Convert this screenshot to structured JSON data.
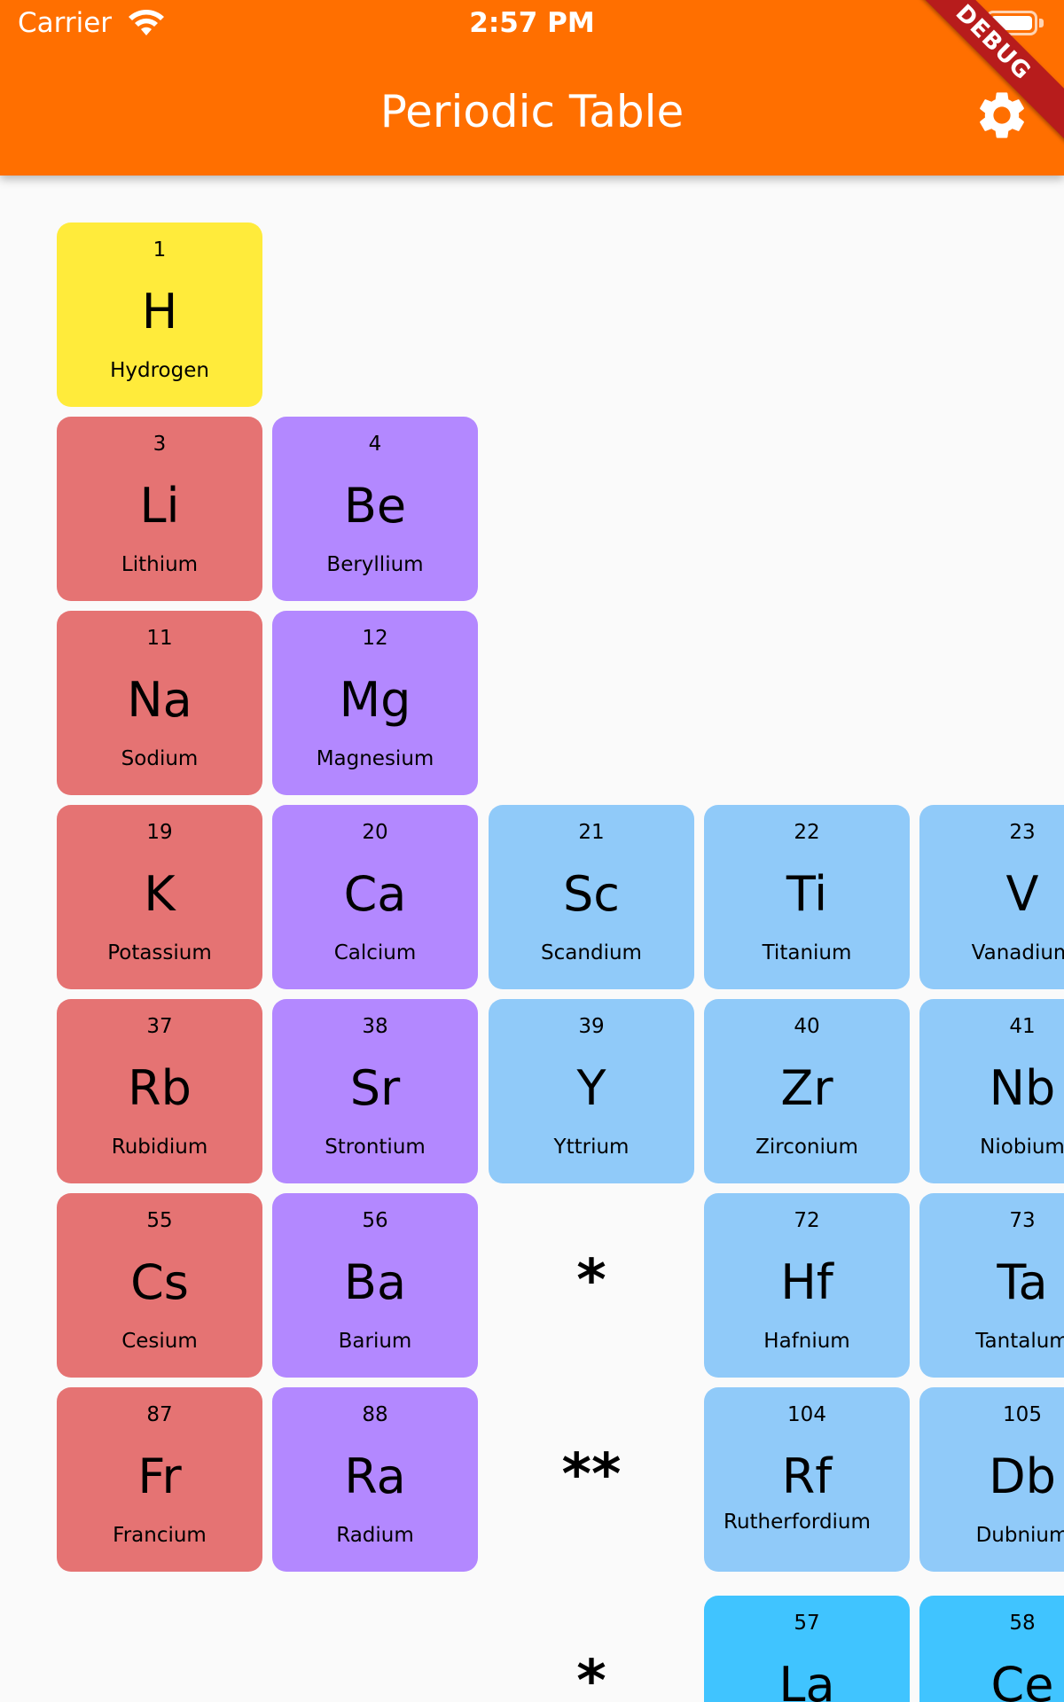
{
  "status_bar": {
    "carrier": "Carrier",
    "time": "2:57 PM"
  },
  "app_bar": {
    "title": "Periodic Table",
    "settings_icon": "gear-icon",
    "debug_label": "DEBUG"
  },
  "colors": {
    "app_bar": "#ff6f00",
    "other_nonmetal": "#ffeb3b",
    "alkali_metal": "#e57373",
    "alkaline_earth_metal": "#b388ff",
    "transition_metal": "#90caf9",
    "lanthanide": "#40c4ff"
  },
  "elements": [
    {
      "number": "1",
      "symbol": "H",
      "name": "Hydrogen",
      "color": "#ffeb3b"
    },
    {
      "number": "3",
      "symbol": "Li",
      "name": "Lithium",
      "color": "#e57373"
    },
    {
      "number": "4",
      "symbol": "Be",
      "name": "Beryllium",
      "color": "#b388ff"
    },
    {
      "number": "11",
      "symbol": "Na",
      "name": "Sodium",
      "color": "#e57373"
    },
    {
      "number": "12",
      "symbol": "Mg",
      "name": "Magnesium",
      "color": "#b388ff"
    },
    {
      "number": "19",
      "symbol": "K",
      "name": "Potassium",
      "color": "#e57373"
    },
    {
      "number": "20",
      "symbol": "Ca",
      "name": "Calcium",
      "color": "#b388ff"
    },
    {
      "number": "21",
      "symbol": "Sc",
      "name": "Scandium",
      "color": "#90caf9"
    },
    {
      "number": "22",
      "symbol": "Ti",
      "name": "Titanium",
      "color": "#90caf9"
    },
    {
      "number": "23",
      "symbol": "V",
      "name": "Vanadium",
      "color": "#90caf9"
    },
    {
      "number": "37",
      "symbol": "Rb",
      "name": "Rubidium",
      "color": "#e57373"
    },
    {
      "number": "38",
      "symbol": "Sr",
      "name": "Strontium",
      "color": "#b388ff"
    },
    {
      "number": "39",
      "symbol": "Y",
      "name": "Yttrium",
      "color": "#90caf9"
    },
    {
      "number": "40",
      "symbol": "Zr",
      "name": "Zirconium",
      "color": "#90caf9"
    },
    {
      "number": "41",
      "symbol": "Nb",
      "name": "Niobium",
      "color": "#90caf9"
    },
    {
      "number": "55",
      "symbol": "Cs",
      "name": "Cesium",
      "color": "#e57373"
    },
    {
      "number": "56",
      "symbol": "Ba",
      "name": "Barium",
      "color": "#b388ff"
    },
    {
      "number": "72",
      "symbol": "Hf",
      "name": "Hafnium",
      "color": "#90caf9"
    },
    {
      "number": "73",
      "symbol": "Ta",
      "name": "Tantalum",
      "color": "#90caf9"
    },
    {
      "number": "87",
      "symbol": "Fr",
      "name": "Francium",
      "color": "#e57373"
    },
    {
      "number": "88",
      "symbol": "Ra",
      "name": "Radium",
      "color": "#b388ff"
    },
    {
      "number": "104",
      "symbol": "Rf",
      "name": "Rutherfordium",
      "color": "#90caf9"
    },
    {
      "number": "105",
      "symbol": "Db",
      "name": "Dubnium",
      "color": "#90caf9"
    },
    {
      "number": "57",
      "symbol": "La",
      "name": "",
      "color": "#40c4ff"
    },
    {
      "number": "58",
      "symbol": "Ce",
      "name": "",
      "color": "#40c4ff"
    }
  ],
  "markers": {
    "lanthanide": "*",
    "actinide": "**"
  }
}
